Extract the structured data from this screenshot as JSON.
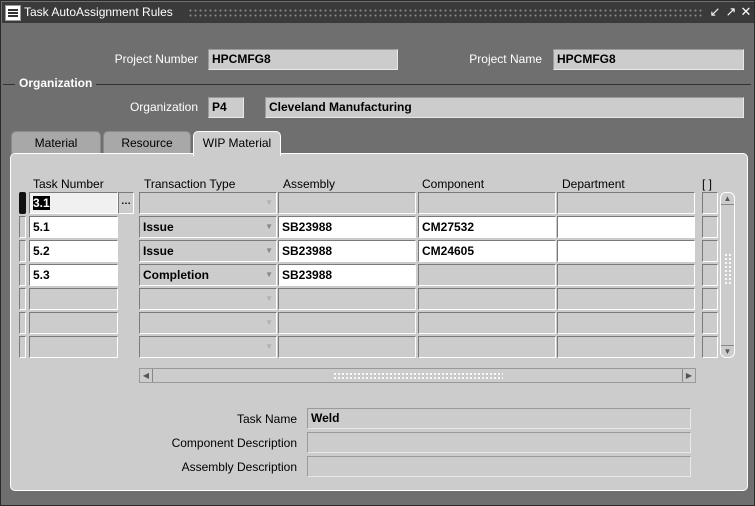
{
  "window": {
    "title": "Task AutoAssignment Rules",
    "controls": {
      "minimize": "↙",
      "maximize": "↗",
      "close": "✕"
    }
  },
  "header": {
    "project_number_label": "Project Number",
    "project_number_value": "HPCMFG8",
    "project_name_label": "Project Name",
    "project_name_value": "HPCMFG8"
  },
  "organization": {
    "section_title": "Organization",
    "label": "Organization",
    "code": "P4",
    "name": "Cleveland Manufacturing"
  },
  "tabs": [
    {
      "label": "Material",
      "active": false
    },
    {
      "label": "Resource",
      "active": false
    },
    {
      "label": "WIP Material",
      "active": true
    }
  ],
  "table": {
    "columns": [
      "Task Number",
      "Transaction Type",
      "Assembly",
      "Component",
      "Department",
      "[ ]"
    ],
    "lov_button": "…",
    "rows": [
      {
        "task_number": "3.1",
        "transaction_type": "",
        "assembly": "",
        "component": "",
        "department": ""
      },
      {
        "task_number": "5.1",
        "transaction_type": "Issue",
        "assembly": "SB23988",
        "component": "CM27532",
        "department": ""
      },
      {
        "task_number": "5.2",
        "transaction_type": "Issue",
        "assembly": "SB23988",
        "component": "CM24605",
        "department": ""
      },
      {
        "task_number": "5.3",
        "transaction_type": "Completion",
        "assembly": "SB23988",
        "component": "",
        "department": ""
      },
      {
        "task_number": "",
        "transaction_type": "",
        "assembly": "",
        "component": "",
        "department": ""
      },
      {
        "task_number": "",
        "transaction_type": "",
        "assembly": "",
        "component": "",
        "department": ""
      },
      {
        "task_number": "",
        "transaction_type": "",
        "assembly": "",
        "component": "",
        "department": ""
      }
    ]
  },
  "details": {
    "task_name_label": "Task Name",
    "task_name_value": "Weld",
    "component_description_label": "Component Description",
    "component_description_value": "",
    "assembly_description_label": "Assembly Description",
    "assembly_description_value": ""
  },
  "icons": {
    "dropdown": "▼",
    "scroll_up": "▲",
    "scroll_down": "▼",
    "scroll_left": "◀",
    "scroll_right": "▶"
  }
}
